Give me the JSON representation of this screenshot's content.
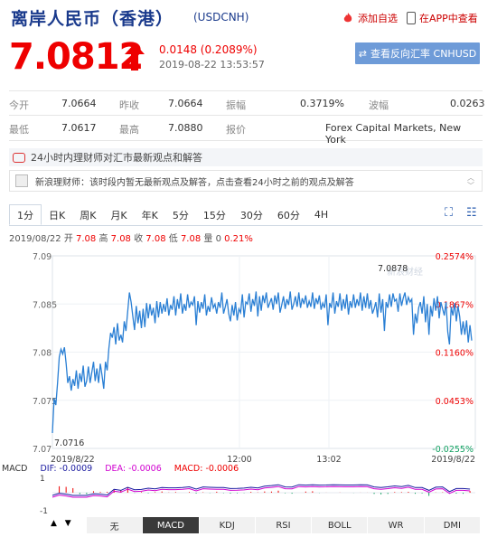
{
  "header": {
    "title": "离岸人民币（香港）",
    "code": "(USDCNH)",
    "add_favorite": "添加自选",
    "view_in_app": "在APP中查看"
  },
  "quote": {
    "price": "7.0812",
    "change": "0.0148 (0.2089%)",
    "datetime": "2019-08-22 13:53:57",
    "reverse_button": "查看反向汇率 CNHUSD"
  },
  "stats": {
    "open_label": "今开",
    "open": "7.0664",
    "prev_close_label": "昨收",
    "prev_close": "7.0664",
    "amplitude_label": "振幅",
    "amplitude": "0.3719%",
    "wave_label": "波幅",
    "wave": "0.0263",
    "low_label": "最低",
    "low": "7.0617",
    "high_label": "最高",
    "high": "7.0880",
    "quote_label": "报价",
    "quote_source": "Forex Capital Markets, New York"
  },
  "topic": {
    "text": "24小时内理财师对汇市最新观点和解答",
    "ticker": "新浪理财师：该时段内暂无最新观点及解答，点击查看24小时之前的观点及解答"
  },
  "tabs": [
    "1分",
    "日K",
    "周K",
    "月K",
    "年K",
    "5分",
    "15分",
    "30分",
    "60分",
    "4H"
  ],
  "ohlc": {
    "date": "2019/08/22",
    "open_label": "开",
    "open": "7.08",
    "high_label": "高",
    "high": "7.08",
    "close_label": "收",
    "close": "7.08",
    "low_label": "低",
    "low": "7.08",
    "vol_label": "量",
    "vol": "0",
    "pct": "0.21%"
  },
  "chart_data": {
    "type": "line",
    "title": "",
    "ylim": [
      7.07,
      7.09
    ],
    "y_ticks_left": [
      "7.09",
      "7.085",
      "7.08",
      "7.075",
      "7.07"
    ],
    "y_ticks_right": [
      "0.2574%",
      "0.1867%",
      "0.1160%",
      "0.0453%",
      "-0.0255%"
    ],
    "x_ticks": [
      "2019/8/22",
      "12:00",
      "13:02",
      "2019/8/22"
    ],
    "annotations": [
      "7.0878",
      "7.0716"
    ],
    "watermark": "新浪财经",
    "series": [
      {
        "values": [
          7.0716,
          7.0752,
          7.0745,
          7.0768,
          7.0795,
          7.0803,
          7.0798,
          7.0805,
          7.0788,
          7.0768,
          7.0775,
          7.076,
          7.0772,
          7.0765,
          7.0781,
          7.0762,
          7.0778,
          7.0769,
          7.0786,
          7.0764,
          7.077,
          7.0785,
          7.0768,
          7.0779,
          7.079,
          7.077,
          7.0783,
          7.0768,
          7.0788,
          7.0776,
          7.0762,
          7.079,
          7.0781,
          7.0804,
          7.082,
          7.0815,
          7.0826,
          7.0808,
          7.083,
          7.0812,
          7.0818,
          7.081,
          7.0832,
          7.0822,
          7.0842,
          7.0862,
          7.0852,
          7.0837,
          7.0823,
          7.0848,
          7.083,
          7.0843,
          7.0825,
          7.0845,
          7.0826,
          7.0851,
          7.0835,
          7.085,
          7.0838,
          7.0846,
          7.083,
          7.0853,
          7.0836,
          7.0852,
          7.084,
          7.085,
          7.0842,
          7.0856,
          7.0838,
          7.0849,
          7.0844,
          7.0858,
          7.0838,
          7.0855,
          7.0845,
          7.0861,
          7.084,
          7.085,
          7.0843,
          7.086,
          7.0846,
          7.0852,
          7.0849,
          7.0858,
          7.0828,
          7.0853,
          7.0841,
          7.0852,
          7.0845,
          7.086,
          7.0838,
          7.0848,
          7.0842,
          7.0857,
          7.0846,
          7.085,
          7.084,
          7.0852,
          7.0846,
          7.0862,
          7.084,
          7.0847,
          7.0855,
          7.084,
          7.0832,
          7.0849,
          7.0838,
          7.0852,
          7.0833,
          7.0845,
          7.0841,
          7.086,
          7.0836,
          7.0852,
          7.085,
          7.0861,
          7.0842,
          7.0855,
          7.0848,
          7.0863,
          7.0837,
          7.0858,
          7.0843,
          7.0859,
          7.0851,
          7.0862,
          7.0846,
          7.0851,
          7.0856,
          7.0844,
          7.0859,
          7.085,
          7.0862,
          7.0841,
          7.0849,
          7.0858,
          7.0845,
          7.0855,
          7.0849,
          7.0863,
          7.0844,
          7.085,
          7.0858,
          7.0847,
          7.0862,
          7.0846,
          7.0856,
          7.085,
          7.0859,
          7.0846,
          7.0853,
          7.0847,
          7.0862,
          7.0845,
          7.0856,
          7.085,
          7.0859,
          7.0844,
          7.0851,
          7.0846,
          7.086,
          7.0828,
          7.0851,
          7.0846,
          7.0862,
          7.084,
          7.0853,
          7.0847,
          7.0861,
          7.0843,
          7.0855,
          7.0845,
          7.086,
          7.0839,
          7.0853,
          7.0846,
          7.086,
          7.0846,
          7.0855,
          7.0848,
          7.0862,
          7.0843,
          7.0858,
          7.0846,
          7.0861,
          7.0845,
          7.0854,
          7.084,
          7.0845,
          7.0852,
          7.0836,
          7.0861,
          7.0841,
          7.0855,
          7.0822,
          7.0852,
          7.0846,
          7.086,
          7.0847,
          7.0861,
          7.0853,
          7.0855,
          7.0842,
          7.0861,
          7.0848,
          7.0856,
          7.0862,
          7.0849,
          7.0857,
          7.0852,
          7.0855,
          7.0818,
          7.084,
          7.083,
          7.0846,
          7.0852,
          7.084,
          7.0858,
          7.0831,
          7.085,
          7.0818,
          7.0848,
          7.0837,
          7.0856,
          7.0843,
          7.0858,
          7.0835,
          7.0852,
          7.0845,
          7.0838,
          7.0852,
          7.0821,
          7.0808,
          7.0847,
          7.0838,
          7.0851,
          7.0832,
          7.0848,
          7.0837,
          7.0818,
          7.0832,
          7.0818,
          7.0833,
          7.081,
          7.0828,
          7.0812
        ]
      }
    ]
  },
  "macd": {
    "label": "MACD",
    "dif": "DIF: -0.0009",
    "dea": "DEA: -0.0006",
    "macd": "MACD: -0.0006",
    "y_ticks": [
      "1",
      "-1"
    ],
    "colors": {
      "dif": "#1a1aa0",
      "dea": "#d000d0",
      "macd": "#e00",
      "up": "#e00",
      "down": "#11a060"
    }
  },
  "bottom_tabs": [
    "无",
    "MACD",
    "KDJ",
    "RSI",
    "BOLL",
    "WR",
    "DMI"
  ],
  "nav": {
    "up": "▲",
    "down": "▼"
  }
}
